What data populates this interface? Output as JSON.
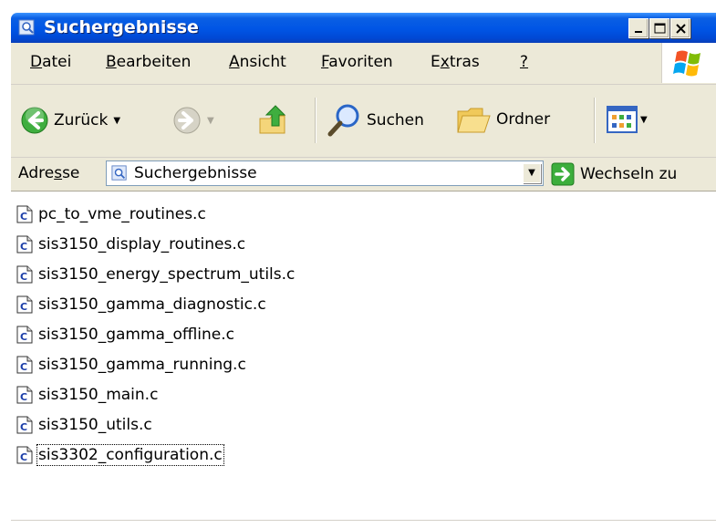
{
  "window": {
    "title": "Suchergebnisse",
    "title_icon": "search-results-icon"
  },
  "titlebar_buttons": [
    {
      "name": "minimize",
      "icon": "minimize-icon"
    },
    {
      "name": "maximize",
      "icon": "maximize-icon"
    },
    {
      "name": "close",
      "icon": "close-icon"
    }
  ],
  "menu": {
    "items": [
      {
        "label_pre": "",
        "label_u": "D",
        "label_post": "atei"
      },
      {
        "label_pre": "",
        "label_u": "B",
        "label_post": "earbeiten"
      },
      {
        "label_pre": "",
        "label_u": "A",
        "label_post": "nsicht"
      },
      {
        "label_pre": "",
        "label_u": "F",
        "label_post": "avoriten"
      },
      {
        "label_pre": "E",
        "label_u": "x",
        "label_post": "tras"
      },
      {
        "label_pre": "",
        "label_u": "?",
        "label_post": ""
      }
    ],
    "logo": "windows-flag-icon"
  },
  "toolbar": {
    "back_label": "Zurück",
    "search_label": "Suchen",
    "folders_label": "Ordner",
    "icons": {
      "back": "back-arrow-icon",
      "forward": "forward-arrow-icon",
      "up": "folder-up-icon",
      "search": "magnifier-icon",
      "folders": "folder-icon",
      "views": "views-icon"
    }
  },
  "address": {
    "label_pre": "Adre",
    "label_u": "s",
    "label_post": "se",
    "value": "Suchergebnisse",
    "go_label": "Wechseln zu"
  },
  "files": [
    {
      "name": "pc_to_vme_routines.c"
    },
    {
      "name": "sis3150_display_routines.c"
    },
    {
      "name": "sis3150_energy_spectrum_utils.c"
    },
    {
      "name": "sis3150_gamma_diagnostic.c"
    },
    {
      "name": "sis3150_gamma_offline.c"
    },
    {
      "name": "sis3150_gamma_running.c"
    },
    {
      "name": "sis3150_main.c"
    },
    {
      "name": "sis3150_utils.c"
    },
    {
      "name": "sis3302_configuration.c",
      "focused": true
    }
  ],
  "colors": {
    "titlebar": "#0055e5",
    "chrome": "#ece9d8",
    "go_green": "#3cae3c",
    "back_green": "#33a333"
  }
}
